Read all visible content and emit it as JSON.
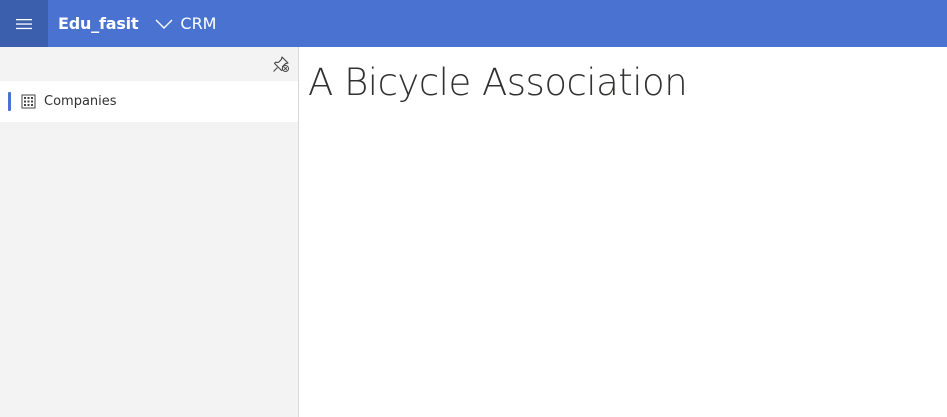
{
  "topbar": {
    "app_name": "Edu_fasit",
    "module_name": "CRM",
    "accent_color": "#4a73d1",
    "menu_icon": "hamburger-icon",
    "switcher_icon": "chevron-down-icon"
  },
  "sidebar": {
    "pin_icon": "unpin-icon",
    "items": [
      {
        "label": "Companies",
        "icon": "building-icon",
        "selected": true
      }
    ]
  },
  "main": {
    "title": "A Bicycle Association"
  }
}
